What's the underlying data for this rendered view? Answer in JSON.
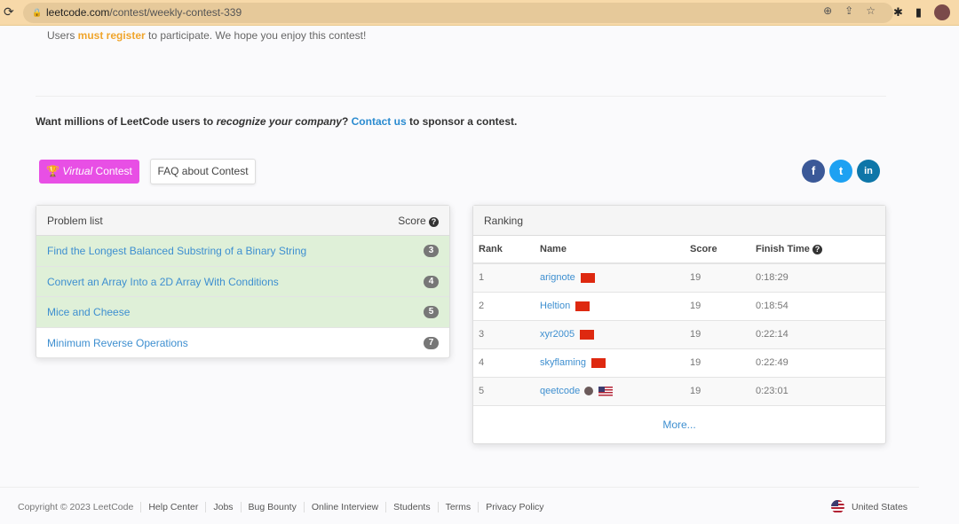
{
  "browser": {
    "url_host": "leetcode.com",
    "url_path": "/contest/weekly-contest-339"
  },
  "intro": {
    "pre": "Users ",
    "bold": "must register",
    "post": " to participate. We hope you enjoy this contest!"
  },
  "sponsor": {
    "a": "Want millions of LeetCode users to ",
    "b": "recognize your company",
    "c": "? ",
    "link": "Contact us",
    "d": " to sponsor a contest."
  },
  "buttons": {
    "virtual_em": "Virtual",
    "virtual_rest": " Contest",
    "faq": "FAQ about Contest"
  },
  "social": {
    "facebook": "f",
    "twitter": "t",
    "linkedin": "in",
    "facebook_color": "#3b5998",
    "twitter_color": "#1da1f2",
    "linkedin_color": "#0e76a8"
  },
  "problems": {
    "title": "Problem list",
    "score_label": "Score",
    "items": [
      {
        "title": "Find the Longest Balanced Substring of a Binary String",
        "score": "3"
      },
      {
        "title": "Convert an Array Into a 2D Array With Conditions",
        "score": "4"
      },
      {
        "title": "Mice and Cheese",
        "score": "5"
      },
      {
        "title": "Minimum Reverse Operations",
        "score": "7"
      }
    ]
  },
  "ranking": {
    "title": "Ranking",
    "headers": [
      "Rank",
      "Name",
      "Score",
      "Finish Time"
    ],
    "rows": [
      {
        "rank": "1",
        "name": "arignote",
        "score": "19",
        "time": "0:18:29"
      },
      {
        "rank": "2",
        "name": "Heltion",
        "score": "19",
        "time": "0:18:54"
      },
      {
        "rank": "3",
        "name": "xyr2005",
        "score": "19",
        "time": "0:22:14"
      },
      {
        "rank": "4",
        "name": "skyflaming",
        "score": "19",
        "time": "0:22:49"
      },
      {
        "rank": "5",
        "name": "qeetcode",
        "score": "19",
        "time": "0:23:01"
      }
    ],
    "more": "More..."
  },
  "footer": {
    "copyright": "Copyright © 2023 LeetCode",
    "links": [
      "Help Center",
      "Jobs",
      "Bug Bounty",
      "Online Interview",
      "Students",
      "Terms",
      "Privacy Policy"
    ],
    "region": "United States"
  }
}
